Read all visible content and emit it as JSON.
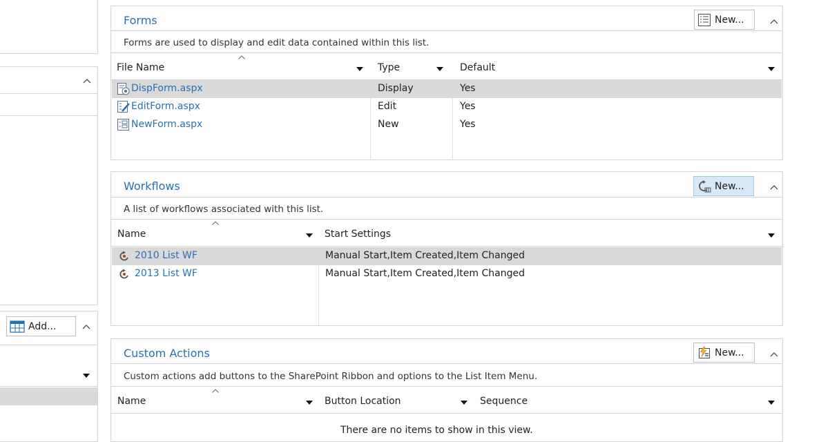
{
  "left_column": {
    "add_button": {
      "label": "Add..."
    }
  },
  "forms": {
    "title": "Forms",
    "new_button": "New...",
    "description": "Forms are used to display and edit data contained within this list.",
    "columns": [
      "File Name",
      "Type",
      "Default"
    ],
    "rows": [
      {
        "file": "DispForm.aspx",
        "type": "Display",
        "default": "Yes",
        "selected": true
      },
      {
        "file": "EditForm.aspx",
        "type": "Edit",
        "default": "Yes",
        "selected": false
      },
      {
        "file": "NewForm.aspx",
        "type": "New",
        "default": "Yes",
        "selected": false
      }
    ]
  },
  "workflows": {
    "title": "Workflows",
    "new_button": "New...",
    "description": "A list of workflows associated with this list.",
    "columns": [
      "Name",
      "Start Settings"
    ],
    "rows": [
      {
        "name": "2010 List WF",
        "start": "Manual Start,Item Created,Item Changed",
        "selected": true
      },
      {
        "name": "2013 List WF",
        "start": "Manual Start,Item Created,Item Changed",
        "selected": false
      }
    ]
  },
  "custom_actions": {
    "title": "Custom Actions",
    "new_button": "New...",
    "description": "Custom actions add buttons to the SharePoint Ribbon and options to the List Item Menu.",
    "columns": [
      "Name",
      "Button Location",
      "Sequence"
    ],
    "empty_message": "There are no items to show in this view."
  },
  "colors": {
    "title_blue": "#2a6fb5",
    "selected_row": "#d9d9d9",
    "active_button": "#d7e8f8",
    "border": "#d4d4d4"
  }
}
